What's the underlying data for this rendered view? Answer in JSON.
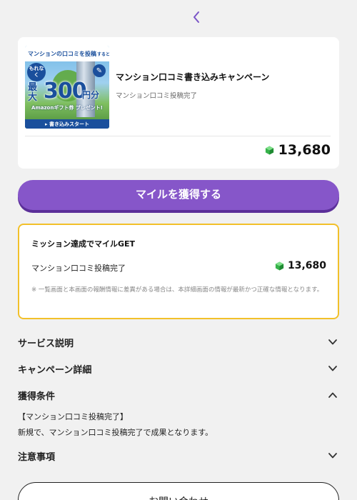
{
  "nav": {
    "back_icon": "chevron-left-icon"
  },
  "campaign": {
    "banner": {
      "top_text": "マンションの口コミを投稿",
      "top_text_small": "すると",
      "badge": "もれなく",
      "max_label": "最大",
      "amount": "300",
      "unit": "円分",
      "gift_text": "Amazonギフト券 プレゼント!",
      "cta": "▸ 書き込みスタート"
    },
    "title": "マンション口コミ書き込みキャンペーン",
    "subtitle": "マンション口コミ投稿完了",
    "reward": "13,680"
  },
  "get_button": "マイルを獲得する",
  "mission": {
    "heading": "ミッション達成でマイルGET",
    "item_label": "マンション口コミ投稿完了",
    "reward": "13,680",
    "note": "※ 一覧画面と本画面の報酬情報に差異がある場合は、本詳細画面の情報が最新かつ正確な情報となります。"
  },
  "sections": {
    "service": "サービス説明",
    "campaign_detail": "キャンペーン詳細",
    "conditions": "獲得条件",
    "conditions_line1": "【マンション口コミ投稿完了】",
    "conditions_line2": "新規で、マンション口コミ投稿完了で成果となります。",
    "notes": "注意事項"
  },
  "contact_button": "お問い合わせ",
  "colors": {
    "accent": "#8656c9",
    "accent_shadow": "#5b2f99",
    "mission_border": "#f2c02a",
    "background": "#f1f1f1"
  }
}
